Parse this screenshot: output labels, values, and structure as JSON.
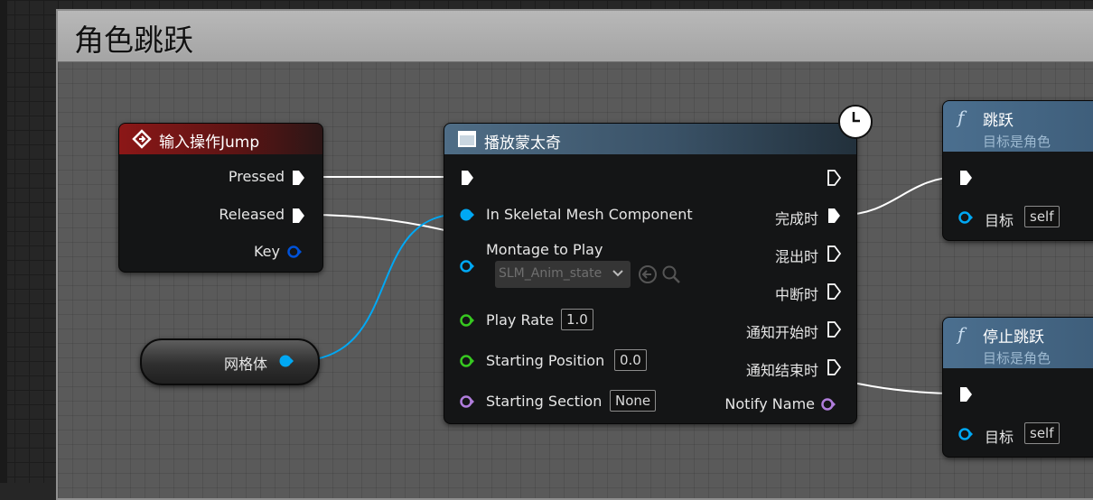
{
  "comment": {
    "title": "角色跳跃"
  },
  "nodes": {
    "input_action": {
      "title": "输入操作Jump",
      "pins": {
        "pressed": "Pressed",
        "released": "Released",
        "key": "Key"
      }
    },
    "play_montage": {
      "title": "播放蒙太奇",
      "inputs": {
        "skeletal_mesh": "In Skeletal Mesh Component",
        "montage": "Montage to Play",
        "montage_value": "SLM_Anim_state",
        "play_rate": "Play Rate",
        "play_rate_value": "1.0",
        "starting_position": "Starting Position",
        "starting_position_value": "0.0",
        "starting_section": "Starting Section",
        "starting_section_value": "None"
      },
      "outputs": {
        "completed": "完成时",
        "blend_out": "混出时",
        "interrupted": "中断时",
        "notify_begin": "通知开始时",
        "notify_end": "通知结束时",
        "notify_name": "Notify Name"
      }
    },
    "mesh_var": {
      "label": "网格体"
    },
    "jump_fn": {
      "icon": "f",
      "title": "跳跃",
      "subtitle": "目标是角色",
      "target_label": "目标",
      "target_value": "self"
    },
    "stop_jump_fn": {
      "icon": "f",
      "title": "停止跳跃",
      "subtitle": "目标是角色",
      "target_label": "目标",
      "target_value": "self"
    }
  },
  "colors": {
    "object_pin": "#00a8f4",
    "float_pin": "#37c820",
    "name_pin": "#b07ddc",
    "key_pin": "#0052d9",
    "exec": "#ffffff"
  }
}
